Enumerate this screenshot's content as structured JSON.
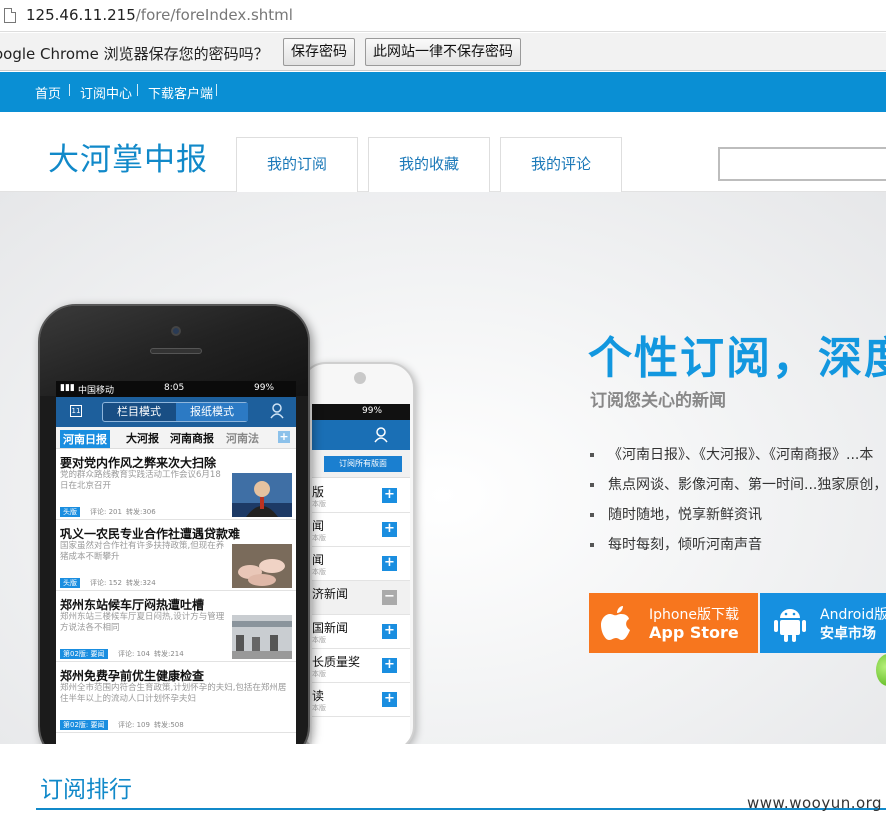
{
  "browser": {
    "url_host": "125.46.11.215",
    "url_path": "/fore/foreIndex.shtml"
  },
  "password_bar": {
    "message": "oogle Chrome 浏览器保存您的密码吗？",
    "save_label": "保存密码",
    "never_label": "此网站一律不保存密码"
  },
  "top_nav": [
    "首页",
    "订阅中心",
    "下载客户端"
  ],
  "header": {
    "logo": "大河掌中报",
    "tabs": [
      "我的订阅",
      "我的收藏",
      "我的评论"
    ]
  },
  "banner": {
    "headline": "个性订阅，深度",
    "subheadline": "订阅您关心的新闻",
    "bullets": [
      "《河南日报》、《大河报》、《河南商报》...本",
      "焦点网谈、影像河南、第一时间...独家原创，任",
      "随时随地，悦享新鲜资讯",
      "每时每刻，倾听河南声音"
    ],
    "appstore_top": "Iphone版下载",
    "appstore_bottom": "App Store",
    "android_top": "Android版",
    "android_bottom": "安卓市场",
    "colors": {
      "accent": "#1297df",
      "appstore": "#f7761e",
      "android": "#1690e0",
      "nav": "#0a8fd4"
    }
  },
  "phone_main": {
    "carrier": "中国移动",
    "time": "8:05",
    "battery": "99%",
    "mode_a": "栏目模式",
    "mode_b": "报纸模式",
    "calendar_day": "11",
    "channels": [
      "河南日报",
      "大河报",
      "河南商报",
      "河南法"
    ],
    "articles": [
      {
        "title": "要对党内作风之弊来次大扫除",
        "desc": "党的群众路线教育实践活动工作会议6月18日在北京召开",
        "tag": "头版",
        "comments": "评论: 201",
        "shares": "转发:306"
      },
      {
        "title": "巩义一农民专业合作社遭遇贷款难",
        "desc": "国家虽然对合作社有许多扶持政策,但现在养猪成本不断攀升",
        "tag": "头版",
        "comments": "评论: 152",
        "shares": "转发:324"
      },
      {
        "title": "郑州东站候车厅闷热遭吐槽",
        "desc": "郑州东站三楼候车厅夏日闷热,设计方与管理方说法各不相同",
        "tag": "第02版: 要闻",
        "comments": "评论: 104",
        "shares": "转发:214"
      },
      {
        "title": "郑州免费孕前优生健康检查",
        "desc": "郑州全市范围内符合生育政策,计划怀孕的夫妇,包括在郑州居住半年以上的流动人口计划怀孕夫妇",
        "tag": "第02版: 要闻",
        "comments": "评论: 109",
        "shares": "转发:508"
      }
    ]
  },
  "phone_second": {
    "battery": "99%",
    "subscribe_label": "订阅所有版面",
    "rows": [
      "版",
      "闻",
      "闻",
      "济新闻",
      "国新闻",
      "长质量奖",
      "读"
    ],
    "row_sub": "本版"
  },
  "section": {
    "title": "订阅排行"
  },
  "watermark": "www.wooyun.org"
}
